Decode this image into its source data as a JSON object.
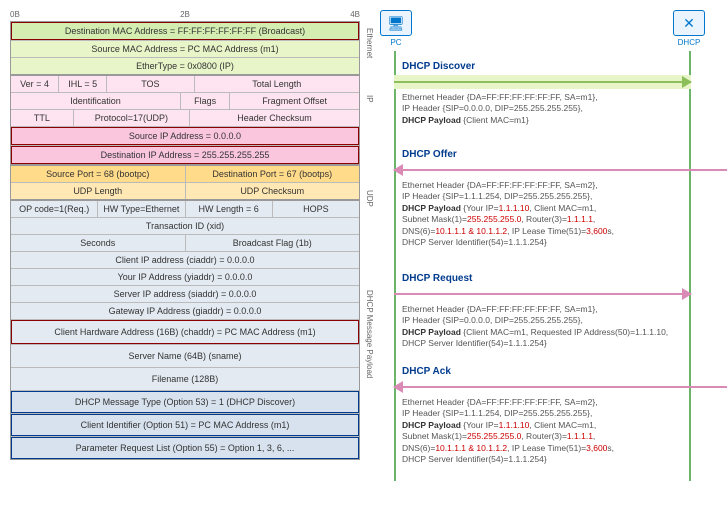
{
  "ruler": {
    "a": "0B",
    "b": "2B",
    "c": "4B"
  },
  "eth": {
    "dmac": "Destination MAC Address = FF:FF:FF:FF:FF:FF (Broadcast)",
    "smac": "Source MAC Address = PC MAC Address (m1)",
    "etype": "EtherType = 0x0800 (IP)"
  },
  "ip": {
    "ver": "Ver = 4",
    "ihl": "IHL = 5",
    "tos": "TOS",
    "tlen": "Total Length",
    "id": "Identification",
    "flags": "Flags",
    "frag": "Fragment Offset",
    "ttl": "TTL",
    "proto": "Protocol=17(UDP)",
    "hcsum": "Header Checksum",
    "sip": "Source IP Address = 0.0.0.0",
    "dip": "Destination IP Address = 255.255.255.255"
  },
  "udp": {
    "sport": "Source Port = 68 (bootpc)",
    "dport": "Destination Port = 67 (bootps)",
    "len": "UDP Length",
    "csum": "UDP Checksum"
  },
  "dhcp": {
    "op": "OP code=1(Req.)",
    "hwt": "HW Type=Ethernet",
    "hwl": "HW Length = 6",
    "hops": "HOPS",
    "xid": "Transaction ID (xid)",
    "secs": "Seconds",
    "bflag": "Broadcast Flag (1b)",
    "ciaddr": "Client IP address (ciaddr) = 0.0.0.0",
    "yiaddr": "Your IP Address (yiaddr) = 0.0.0.0",
    "siaddr": "Server IP address (siaddr) = 0.0.0.0",
    "giaddr": "Gateway IP Address (giaddr) = 0.0.0.0",
    "chaddr": "Client Hardware Address (16B) (chaddr) = PC MAC Address (m1)",
    "sname": "Server Name (64B) (sname)",
    "file": "Filename (128B)",
    "opt53": "DHCP Message Type (Option 53) = 1 (DHCP Discover)",
    "opt51": "Client Identifier (Option 51) = PC MAC Address (m1)",
    "opt55": "Parameter Request List (Option 55) = Option 1, 3, 6, ..."
  },
  "layers": {
    "eth": "Ethernet",
    "ip": "IP",
    "udp": "UDP",
    "dhcp": "DHCP Message Payload"
  },
  "actors": {
    "pc": "PC",
    "dhcp": "DHCP"
  },
  "seq": {
    "discover": {
      "title": "DHCP Discover",
      "l1": "Ethernet Header {DA=FF:FF:FF:FF:FF:FF, SA=m1},",
      "l2": "IP Header {SIP=0.0.0.0, DIP=255.255.255.255},",
      "l3a": "DHCP Payload",
      "l3b": "{Client MAC=m1}"
    },
    "offer": {
      "title": "DHCP Offer",
      "l1": "Ethernet Header {DA=FF:FF:FF:FF:FF:FF, SA=m2},",
      "l2": "IP Header {SIP=1.1.1.254, DIP=255.255.255.255},",
      "l3a": "DHCP Payload",
      "l3b": "{Your IP=",
      "l3c": "1.1.1.10",
      "l3d": ", Client MAC=m1,",
      "l4a": "Subnet Mask(1)=",
      "l4b": "255.255.255.0",
      "l4c": ", Router(3)=",
      "l4d": "1.1.1.1",
      "l4e": ",",
      "l5a": "DNS(6)=",
      "l5b": "10.1.1.1 & 10.1.1.2",
      "l5c": ",  IP Lease Time(51)=",
      "l5d": "3,600",
      "l5e": "s,",
      "l6": "DHCP Server Identifier(54)=1.1.1.254}"
    },
    "request": {
      "title": "DHCP Request",
      "l1": "Ethernet Header {DA=FF:FF:FF:FF:FF:FF, SA=m1},",
      "l2": "IP Header {SIP=0.0.0.0, DIP=255.255.255.255},",
      "l3a": "DHCP Payload",
      "l3b": "{Client MAC=m1, Requested IP Address(50)=1.1.1.10,",
      "l4": "DHCP Server Identifier(54)=1.1.1.254}"
    },
    "ack": {
      "title": "DHCP Ack",
      "l1": "Ethernet Header {DA=FF:FF:FF:FF:FF:FF, SA=m2},",
      "l2": "IP Header {SIP=1.1.1.254, DIP=255.255.255.255},",
      "l3a": "DHCP Payload",
      "l3b": "{Your IP=",
      "l3c": "1.1.1.10",
      "l3d": ", Client MAC=m1,",
      "l4a": "Subnet Mask(1)=",
      "l4b": "255.255.255.0",
      "l4c": ", Router(3)=",
      "l4d": "1.1.1.1",
      "l4e": ",",
      "l5a": "DNS(6)=",
      "l5b": "10.1.1.1 & 10.1.1.2",
      "l5c": ", IP Lease Time(51)=",
      "l5d": "3,600",
      "l5e": "s,",
      "l6": "DHCP Server Identifier(54)=1.1.1.254}"
    }
  }
}
